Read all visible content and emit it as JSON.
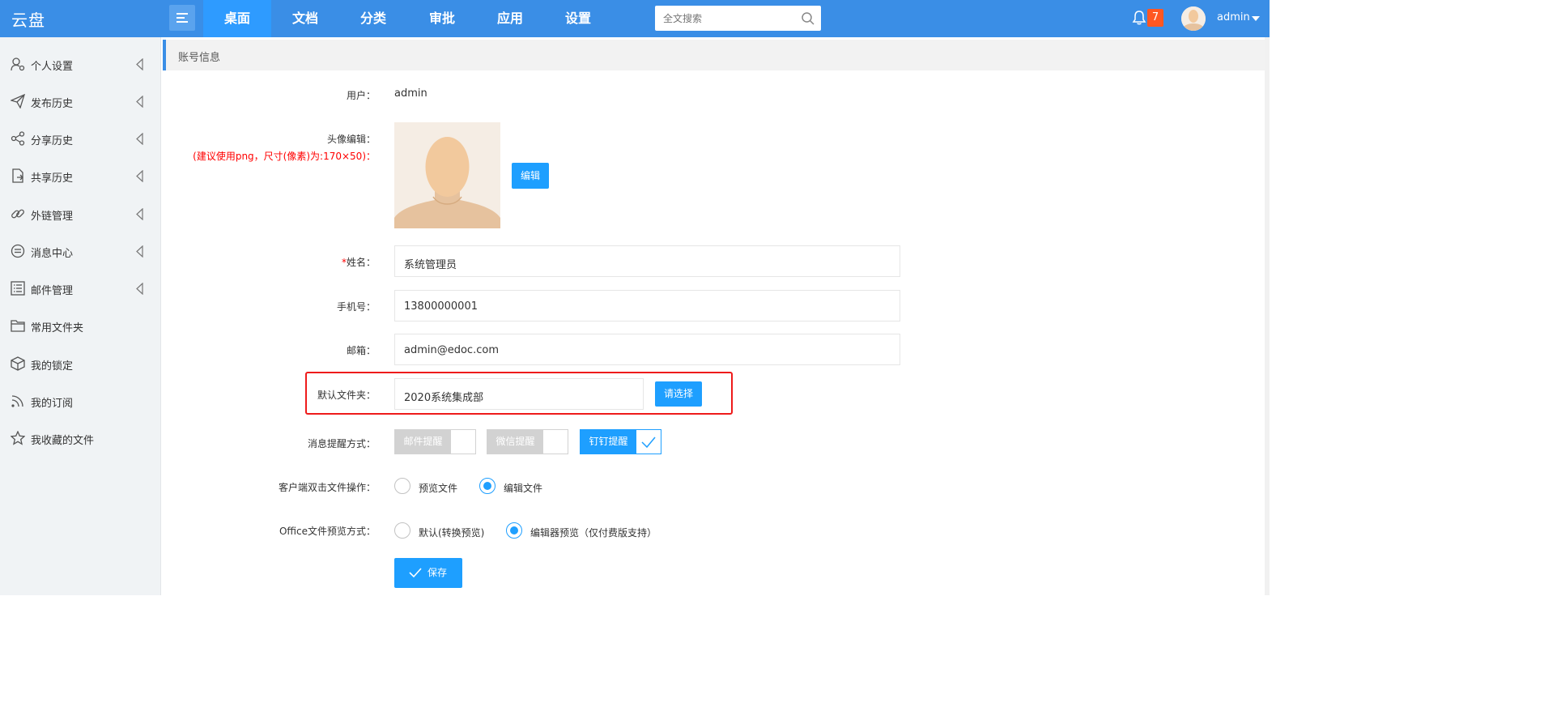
{
  "app": {
    "logo": "云盘"
  },
  "nav": {
    "tabs": [
      {
        "label": "桌面",
        "active": true
      },
      {
        "label": "文档",
        "active": false
      },
      {
        "label": "分类",
        "active": false
      },
      {
        "label": "审批",
        "active": false
      },
      {
        "label": "应用",
        "active": false
      },
      {
        "label": "设置",
        "active": false
      }
    ]
  },
  "search": {
    "placeholder": "全文搜索",
    "icon": "search-icon"
  },
  "notifications": {
    "count": "7",
    "icon": "bell-icon"
  },
  "user": {
    "name": "admin"
  },
  "sidebar": {
    "items": [
      {
        "label": "个人设置",
        "icon": "user-settings-icon",
        "expandable": true
      },
      {
        "label": "发布历史",
        "icon": "paper-plane-icon",
        "expandable": true
      },
      {
        "label": "分享历史",
        "icon": "share-icon",
        "expandable": true
      },
      {
        "label": "共享历史",
        "icon": "shared-file-icon",
        "expandable": true
      },
      {
        "label": "外链管理",
        "icon": "link-icon",
        "expandable": true
      },
      {
        "label": "消息中心",
        "icon": "message-icon",
        "expandable": true
      },
      {
        "label": "邮件管理",
        "icon": "list-icon",
        "expandable": true
      },
      {
        "label": "常用文件夹",
        "icon": "folder-icon",
        "expandable": false
      },
      {
        "label": "我的锁定",
        "icon": "lock-box-icon",
        "expandable": false
      },
      {
        "label": "我的订阅",
        "icon": "rss-icon",
        "expandable": false
      },
      {
        "label": "我收藏的文件",
        "icon": "star-icon",
        "expandable": false
      }
    ]
  },
  "breadcrumb": "账号信息",
  "form": {
    "user_label": "用户：",
    "user_value": "admin",
    "avatar_label": "头像编辑：",
    "avatar_hint": "(建议使用png，尺寸(像素)为:170×50)：",
    "edit_button": "编辑",
    "name_required": "*",
    "name_label": "姓名：",
    "name_value": "系统管理员",
    "phone_label": "手机号：",
    "phone_value": "13800000001",
    "email_label": "邮箱：",
    "email_value": "admin@edoc.com",
    "folder_label": "默认文件夹：",
    "folder_value": "2020系统集成部",
    "choose_button": "请选择",
    "notify_label": "消息提醒方式：",
    "notify_options": [
      {
        "label": "邮件提醒",
        "checked": false
      },
      {
        "label": "微信提醒",
        "checked": false
      },
      {
        "label": "钉钉提醒",
        "checked": true
      }
    ],
    "dblclick_label": "客户端双击文件操作：",
    "dblclick_options": [
      {
        "label": "预览文件",
        "checked": false
      },
      {
        "label": "编辑文件",
        "checked": true
      }
    ],
    "office_label": "Office文件预览方式：",
    "office_options": [
      {
        "label": "默认(转换预览)",
        "checked": false
      },
      {
        "label": "编辑器预览（仅付费版支持）",
        "checked": true
      }
    ],
    "save_button": "保存"
  },
  "colors": {
    "primary": "#1e9fff",
    "header": "#3a8ee6",
    "badge": "#ff5722",
    "highlight": "#ee1b1b"
  }
}
